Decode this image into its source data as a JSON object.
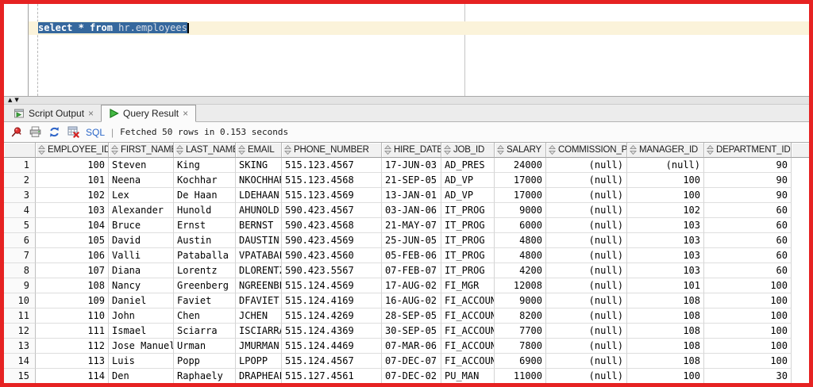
{
  "editor": {
    "query_keywords": "select * from ",
    "query_identifier": "hr.employees",
    "full_query": "select * from hr.employees"
  },
  "splitter": {
    "up_glyph": "▲",
    "down_glyph": "▼"
  },
  "tabs": {
    "script_output": {
      "label": "Script Output",
      "close_glyph": "×"
    },
    "query_result": {
      "label": "Query Result",
      "close_glyph": "×"
    }
  },
  "toolbar": {
    "icons": [
      "pin-icon",
      "print-icon",
      "refresh-icon",
      "delete-fetch-icon"
    ],
    "sql_label": "SQL",
    "separator": "|",
    "status": "Fetched 50 rows in 0.153 seconds"
  },
  "grid": {
    "columns": [
      "EMPLOYEE_ID",
      "FIRST_NAME",
      "LAST_NAME",
      "EMAIL",
      "PHONE_NUMBER",
      "HIRE_DATE",
      "JOB_ID",
      "SALARY",
      "COMMISSION_PCT",
      "MANAGER_ID",
      "DEPARTMENT_ID"
    ],
    "rows": [
      [
        "1",
        "100",
        "Steven",
        "King",
        "SKING",
        "515.123.4567",
        "17-JUN-03",
        "AD_PRES",
        "24000",
        "(null)",
        "(null)",
        "90"
      ],
      [
        "2",
        "101",
        "Neena",
        "Kochhar",
        "NKOCHHAR",
        "515.123.4568",
        "21-SEP-05",
        "AD_VP",
        "17000",
        "(null)",
        "100",
        "90"
      ],
      [
        "3",
        "102",
        "Lex",
        "De Haan",
        "LDEHAAN",
        "515.123.4569",
        "13-JAN-01",
        "AD_VP",
        "17000",
        "(null)",
        "100",
        "90"
      ],
      [
        "4",
        "103",
        "Alexander",
        "Hunold",
        "AHUNOLD",
        "590.423.4567",
        "03-JAN-06",
        "IT_PROG",
        "9000",
        "(null)",
        "102",
        "60"
      ],
      [
        "5",
        "104",
        "Bruce",
        "Ernst",
        "BERNST",
        "590.423.4568",
        "21-MAY-07",
        "IT_PROG",
        "6000",
        "(null)",
        "103",
        "60"
      ],
      [
        "6",
        "105",
        "David",
        "Austin",
        "DAUSTIN",
        "590.423.4569",
        "25-JUN-05",
        "IT_PROG",
        "4800",
        "(null)",
        "103",
        "60"
      ],
      [
        "7",
        "106",
        "Valli",
        "Pataballa",
        "VPATABAL",
        "590.423.4560",
        "05-FEB-06",
        "IT_PROG",
        "4800",
        "(null)",
        "103",
        "60"
      ],
      [
        "8",
        "107",
        "Diana",
        "Lorentz",
        "DLORENTZ",
        "590.423.5567",
        "07-FEB-07",
        "IT_PROG",
        "4200",
        "(null)",
        "103",
        "60"
      ],
      [
        "9",
        "108",
        "Nancy",
        "Greenberg",
        "NGREENBE",
        "515.124.4569",
        "17-AUG-02",
        "FI_MGR",
        "12008",
        "(null)",
        "101",
        "100"
      ],
      [
        "10",
        "109",
        "Daniel",
        "Faviet",
        "DFAVIET",
        "515.124.4169",
        "16-AUG-02",
        "FI_ACCOUNT",
        "9000",
        "(null)",
        "108",
        "100"
      ],
      [
        "11",
        "110",
        "John",
        "Chen",
        "JCHEN",
        "515.124.4269",
        "28-SEP-05",
        "FI_ACCOUNT",
        "8200",
        "(null)",
        "108",
        "100"
      ],
      [
        "12",
        "111",
        "Ismael",
        "Sciarra",
        "ISCIARRA",
        "515.124.4369",
        "30-SEP-05",
        "FI_ACCOUNT",
        "7700",
        "(null)",
        "108",
        "100"
      ],
      [
        "13",
        "112",
        "Jose Manuel",
        "Urman",
        "JMURMAN",
        "515.124.4469",
        "07-MAR-06",
        "FI_ACCOUNT",
        "7800",
        "(null)",
        "108",
        "100"
      ],
      [
        "14",
        "113",
        "Luis",
        "Popp",
        "LPOPP",
        "515.124.4567",
        "07-DEC-07",
        "FI_ACCOUNT",
        "6900",
        "(null)",
        "108",
        "100"
      ],
      [
        "15",
        "114",
        "Den",
        "Raphaely",
        "DRAPHEAL",
        "515.127.4561",
        "07-DEC-02",
        "PU_MAN",
        "11000",
        "(null)",
        "100",
        "30"
      ]
    ]
  },
  "colors": {
    "annotation_border_red": "#e62222",
    "selection_blue": "#35689d",
    "current_line_cream": "#fbf3da",
    "sql_link_blue": "#2a66c8"
  }
}
